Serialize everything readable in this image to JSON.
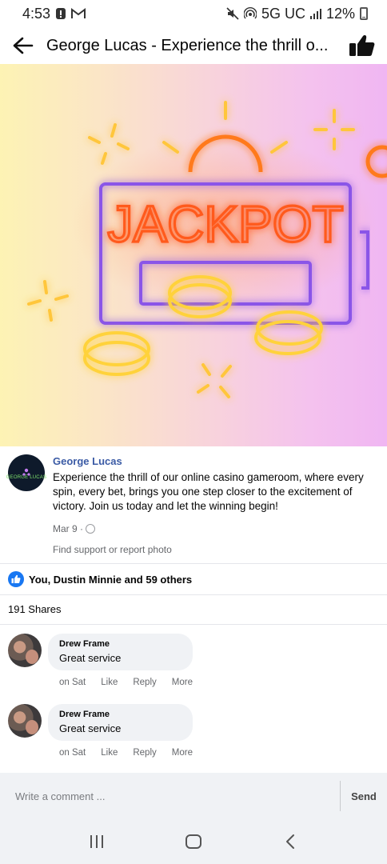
{
  "status_bar": {
    "time": "4:53",
    "network": "5G UC",
    "battery": "12%",
    "icons": [
      "alert-icon",
      "gmail-icon",
      "mute-icon",
      "hotspot-icon",
      "signal-icon",
      "battery-icon"
    ]
  },
  "header": {
    "title": "George Lucas - Experience the thrill o...",
    "back_icon": "arrow-left-icon",
    "like_icon": "thumbs-up-icon"
  },
  "image": {
    "sign_text": "JACKPOT"
  },
  "post": {
    "author": "George Lucas",
    "avatar_text": "GEORGE LUCAS",
    "caption": "Experience the thrill of our online casino gameroom, where every spin, every bet, brings you one step closer to the excitement of victory. Join us today and let the winning begin!",
    "date": "Mar 9 ·",
    "support_link": "Find support or report photo"
  },
  "reactions": {
    "text": "You, Dustin Minnie and 59 others"
  },
  "shares": {
    "text": "191 Shares"
  },
  "comments": [
    {
      "name": "Drew Frame",
      "text": "Great service",
      "time": "on Sat",
      "like": "Like",
      "reply": "Reply",
      "more": "More"
    },
    {
      "name": "Drew Frame",
      "text": "Great service",
      "time": "on Sat",
      "like": "Like",
      "reply": "Reply",
      "more": "More"
    }
  ],
  "composer": {
    "placeholder": "Write a comment ...",
    "send_label": "Send"
  },
  "colors": {
    "brand_blue": "#1877f2",
    "author_blue": "#3b5ba5",
    "muted_text": "#65676b",
    "bubble_bg": "#f0f2f5"
  }
}
